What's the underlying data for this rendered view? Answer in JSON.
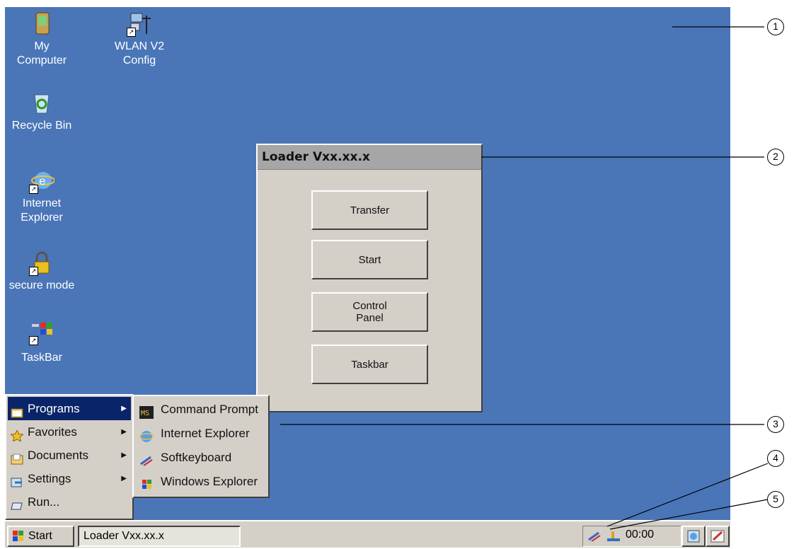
{
  "desktop": {
    "icons": [
      {
        "id": "my-computer",
        "label_line1": "My",
        "label_line2": "Computer",
        "icon": "pda-icon"
      },
      {
        "id": "wlan",
        "label_line1": "WLAN V2",
        "label_line2": "Config",
        "icon": "network-icon"
      },
      {
        "id": "recycle",
        "label_line1": "Recycle Bin",
        "label_line2": "",
        "icon": "recycle-bin-icon"
      },
      {
        "id": "ie",
        "label_line1": "Internet",
        "label_line2": "Explorer",
        "icon": "internet-explorer-icon"
      },
      {
        "id": "secure",
        "label_line1": "secure mode",
        "label_line2": "",
        "icon": "lock-icon"
      },
      {
        "id": "taskbar-app",
        "label_line1": "TaskBar",
        "label_line2": "",
        "icon": "windows-flag-icon"
      }
    ]
  },
  "loader": {
    "title": "Loader Vxx.xx.x",
    "buttons": {
      "transfer": "Transfer",
      "start": "Start",
      "control_panel": "Control\nPanel",
      "taskbar": "Taskbar"
    }
  },
  "start_menu": {
    "items": [
      {
        "label": "Programs",
        "icon": "programs-folder-icon",
        "submenu": true
      },
      {
        "label": "Favorites",
        "icon": "star-icon",
        "submenu": true
      },
      {
        "label": "Documents",
        "icon": "documents-folder-icon",
        "submenu": true
      },
      {
        "label": "Settings",
        "icon": "settings-icon",
        "submenu": true
      },
      {
        "label": "Run...",
        "icon": "run-icon",
        "submenu": false
      }
    ]
  },
  "programs_submenu": {
    "items": [
      {
        "label": "Command Prompt",
        "icon": "command-prompt-icon"
      },
      {
        "label": "Internet Explorer",
        "icon": "internet-explorer-icon"
      },
      {
        "label": "Softkeyboard",
        "icon": "keyboard-icon"
      },
      {
        "label": "Windows Explorer",
        "icon": "windows-explorer-icon"
      }
    ]
  },
  "taskbar": {
    "start_label": "Start",
    "task_button": "Loader Vxx.xx.x",
    "clock": "00:00"
  },
  "callouts": [
    "1",
    "2",
    "3",
    "4",
    "5"
  ],
  "colors": {
    "desktop": "#4a76b8",
    "window": "#d4d0c8",
    "titlebar": "#a6a6a6",
    "highlight": "#0a246a"
  }
}
